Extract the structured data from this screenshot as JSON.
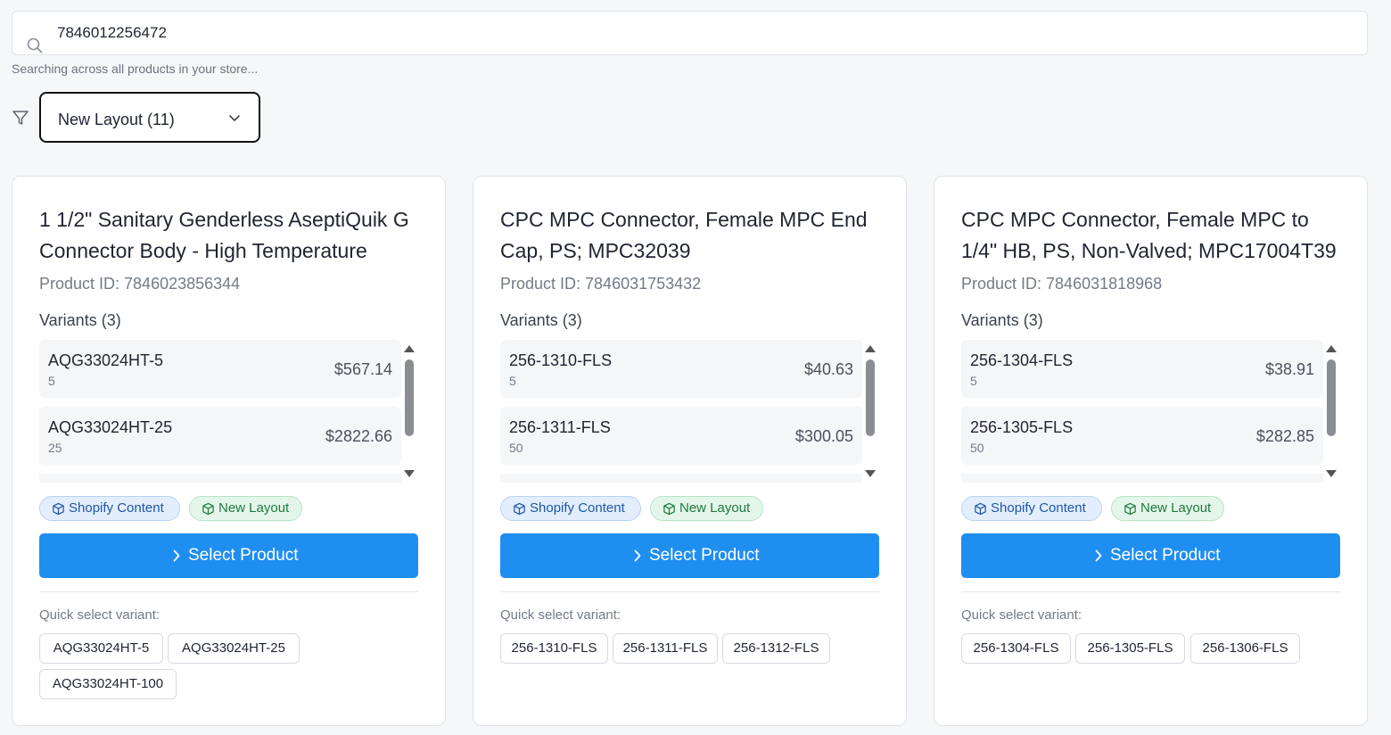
{
  "search": {
    "value": "7846012256472",
    "hint": "Searching across all products in your store..."
  },
  "filter": {
    "selected": "New Layout (11)"
  },
  "cards": [
    {
      "title": "1 1/2\" Sanitary Genderless AseptiQuik G Connector Body - High Temperature",
      "product_id": "Product ID: 7846023856344",
      "variants_heading": "Variants (3)",
      "variants": [
        {
          "sku": "AQG33024HT-5",
          "qty": "5",
          "price": "$567.14"
        },
        {
          "sku": "AQG33024HT-25",
          "qty": "25",
          "price": "$2822.66"
        }
      ],
      "tags": [
        "Shopify Content",
        "New Layout"
      ],
      "button_label": "Select Product",
      "quick_label": "Quick select variant:",
      "quick_variants": [
        "AQG33024HT-5",
        "AQG33024HT-25",
        "AQG33024HT-100"
      ]
    },
    {
      "title": "CPC MPC Connector, Female MPC End Cap, PS; MPC32039",
      "product_id": "Product ID: 7846031753432",
      "variants_heading": "Variants (3)",
      "variants": [
        {
          "sku": "256-1310-FLS",
          "qty": "5",
          "price": "$40.63"
        },
        {
          "sku": "256-1311-FLS",
          "qty": "50",
          "price": "$300.05"
        }
      ],
      "tags": [
        "Shopify Content",
        "New Layout"
      ],
      "button_label": "Select Product",
      "quick_label": "Quick select variant:",
      "quick_variants": [
        "256-1310-FLS",
        "256-1311-FLS",
        "256-1312-FLS"
      ]
    },
    {
      "title": "CPC MPC Connector, Female MPC to 1/4\" HB, PS, Non-Valved; MPC17004T39",
      "product_id": "Product ID: 7846031818968",
      "variants_heading": "Variants (3)",
      "variants": [
        {
          "sku": "256-1304-FLS",
          "qty": "5",
          "price": "$38.91"
        },
        {
          "sku": "256-1305-FLS",
          "qty": "50",
          "price": "$282.85"
        }
      ],
      "tags": [
        "Shopify Content",
        "New Layout"
      ],
      "button_label": "Select Product",
      "quick_label": "Quick select variant:",
      "quick_variants": [
        "256-1304-FLS",
        "256-1305-FLS",
        "256-1306-FLS"
      ]
    }
  ],
  "colors": {
    "primary_button": "#1f8ef1",
    "tag_blue": "#e3eefc",
    "tag_green": "#e4f6ea"
  },
  "icons": [
    "search-icon",
    "filter-icon",
    "chevron-down-icon",
    "cube-icon",
    "chevron-right-icon"
  ]
}
